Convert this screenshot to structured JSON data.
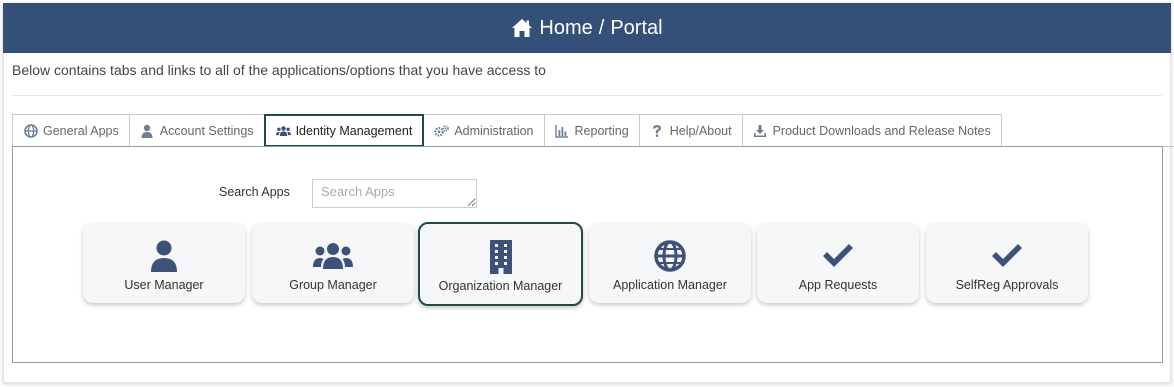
{
  "header": {
    "title_home": "Home",
    "separator": "/",
    "title_portal": "Portal",
    "icon": "home-icon",
    "bg_color": "#345079"
  },
  "intro_text": "Below contains tabs and links to all of the applications/options that you have access to",
  "tabs": [
    {
      "label": "General Apps",
      "icon": "globe-icon"
    },
    {
      "label": "Account Settings",
      "icon": "user-icon"
    },
    {
      "label": "Identity Management",
      "icon": "users-icon",
      "active": true
    },
    {
      "label": "Administration",
      "icon": "gears-icon"
    },
    {
      "label": "Reporting",
      "icon": "bar-chart-icon"
    },
    {
      "label": "Help/About",
      "icon": "question-icon"
    },
    {
      "label": "Product Downloads and Release Notes",
      "icon": "download-icon"
    }
  ],
  "search": {
    "label": "Search Apps",
    "placeholder": "Search Apps",
    "value": ""
  },
  "apps": [
    {
      "label": "User Manager",
      "icon": "user-icon"
    },
    {
      "label": "Group Manager",
      "icon": "users-icon"
    },
    {
      "label": "Organization Manager",
      "icon": "building-icon",
      "focused": true
    },
    {
      "label": "Application Manager",
      "icon": "globe-icon"
    },
    {
      "label": "App Requests",
      "icon": "check-icon"
    },
    {
      "label": "SelfReg Approvals",
      "icon": "check-icon"
    }
  ],
  "colors": {
    "accent": "#345079",
    "focus_border": "#1f4b45",
    "icon_color": "#3c5278"
  }
}
